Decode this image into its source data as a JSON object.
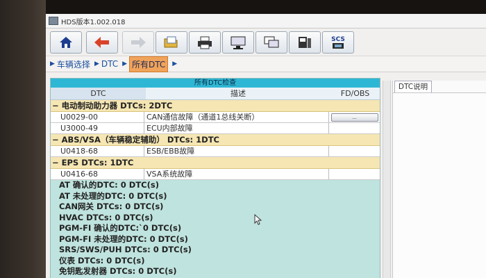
{
  "window": {
    "title": "HDS版本1.002.018"
  },
  "toolbar": {
    "buttons": [
      "home-icon",
      "back-arrow-icon",
      "forward-arrow-icon",
      "folder-open-icon",
      "printer-icon",
      "monitor-icon",
      "screens-icon",
      "save-disk-icon",
      "scs-icon"
    ],
    "scs_label": "SCS"
  },
  "breadcrumb": {
    "items": [
      "车辆选择",
      "DTC",
      "所有DTC"
    ]
  },
  "panel": {
    "title": "所有DTC检查",
    "columns": {
      "dtc": "DTC",
      "desc": "描述",
      "fd": "FD/OBS"
    },
    "groups": [
      {
        "header": "电动制动助力器 DTCs:  2DTC",
        "rows": [
          {
            "code": "U0029-00",
            "desc": "CAN通信故障（通道1总线关断）",
            "fd": "..."
          },
          {
            "code": "U3000-49",
            "desc": "ECU内部故障",
            "fd": ""
          }
        ]
      },
      {
        "header": "ABS/VSA（车辆稳定辅助） DTCs:  1DTC",
        "rows": [
          {
            "code": "U0418-68",
            "desc": "ESB/EBB故障",
            "fd": ""
          }
        ]
      },
      {
        "header": "EPS DTCs:  1DTC",
        "rows": [
          {
            "code": "U0416-68",
            "desc": "VSA系统故障",
            "fd": ""
          }
        ]
      }
    ],
    "summaries": [
      "AT 确认的DTC:  0 DTC(s)",
      "AT 未处理的DTC:  0 DTC(s)",
      "CAN网关 DTCs:  0 DTC(s)",
      "HVAC DTCs:  0 DTC(s)",
      "PGM-FI 确认的DTC:`0 DTC(s)",
      "PGM-FI 未处理的DTC:  0 DTC(s)",
      "SRS/SWS/PUH DTCs:  0 DTC(s)",
      "仪表 DTCs:  0 DTC(s)",
      "免钥匙发射器 DTCs:  0 DTC(s)"
    ]
  },
  "side": {
    "tab_label": "DTC说明"
  },
  "colors": {
    "panel_title": "#2eb7d4",
    "group_bg": "#f5e6b3",
    "breadcrumb_active": "#f0a35a",
    "panel_bg": "#bfe3de"
  }
}
